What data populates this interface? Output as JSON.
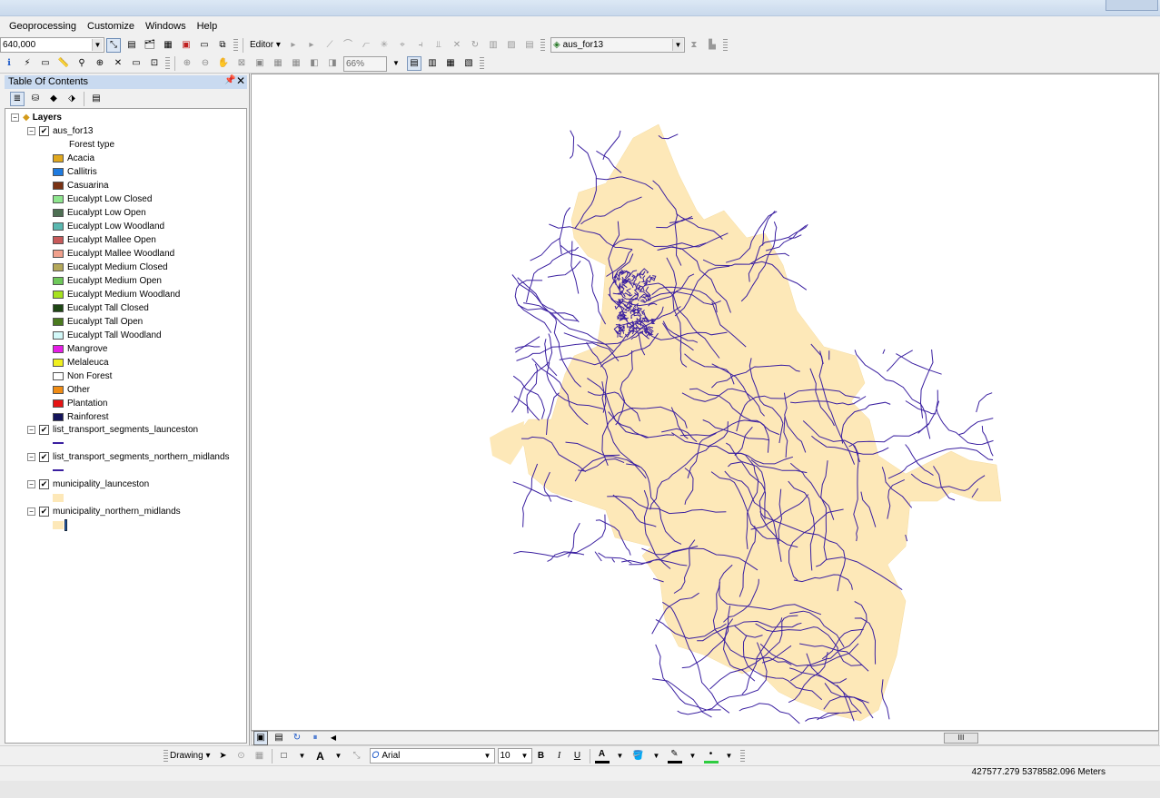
{
  "menu": [
    "Geoprocessing",
    "Customize",
    "Windows",
    "Help"
  ],
  "toolbar": {
    "scale": "640,000",
    "editor_label": "Editor",
    "layer_select": "aus_for13",
    "zoom": "66%"
  },
  "toc": {
    "title": "Table Of Contents",
    "root": "Layers",
    "layers": [
      {
        "name": "aus_for13",
        "checked": true
      },
      {
        "name": "list_transport_segments_launceston",
        "checked": true
      },
      {
        "name": "list_transport_segments_northern_midlands",
        "checked": true
      },
      {
        "name": "municipality_launceston",
        "checked": true
      },
      {
        "name": "municipality_northern_midlands",
        "checked": true
      }
    ],
    "field": "Forest type",
    "legend": [
      {
        "label": "Acacia",
        "color": "#e0a81e"
      },
      {
        "label": "Callitris",
        "color": "#1e7be0"
      },
      {
        "label": "Casuarina",
        "color": "#7a3214"
      },
      {
        "label": "Eucalypt Low Closed",
        "color": "#8ee68e"
      },
      {
        "label": "Eucalypt Low Open",
        "color": "#4e7054"
      },
      {
        "label": "Eucalypt Low Woodland",
        "color": "#5ab8b0"
      },
      {
        "label": "Eucalypt Mallee Open",
        "color": "#c85a5a"
      },
      {
        "label": "Eucalypt Mallee Woodland",
        "color": "#f0a08c"
      },
      {
        "label": "Eucalypt Medium Closed",
        "color": "#b4a85a"
      },
      {
        "label": "Eucalypt Medium Open",
        "color": "#6ec85a"
      },
      {
        "label": "Eucalypt Medium Woodland",
        "color": "#a6e21e"
      },
      {
        "label": "Eucalypt Tall Closed",
        "color": "#1e4614"
      },
      {
        "label": "Eucalypt Tall Open",
        "color": "#4a7a1e"
      },
      {
        "label": "Eucalypt Tall Woodland",
        "color": "#d2f8f8"
      },
      {
        "label": "Mangrove",
        "color": "#e61ee6"
      },
      {
        "label": "Melaleuca",
        "color": "#f0f01e"
      },
      {
        "label": "Non Forest",
        "color": "#ffffff"
      },
      {
        "label": "Other",
        "color": "#f08c14"
      },
      {
        "label": "Plantation",
        "color": "#e61414"
      },
      {
        "label": "Rainforest",
        "color": "#14145a"
      }
    ]
  },
  "drawing": {
    "label": "Drawing",
    "font": "Arial",
    "size": "10"
  },
  "status": {
    "coords": "427577.279  5378582.096 Meters"
  },
  "colors": {
    "municipality_fill": "#fde8b8",
    "roads": "#3a1fa0"
  }
}
